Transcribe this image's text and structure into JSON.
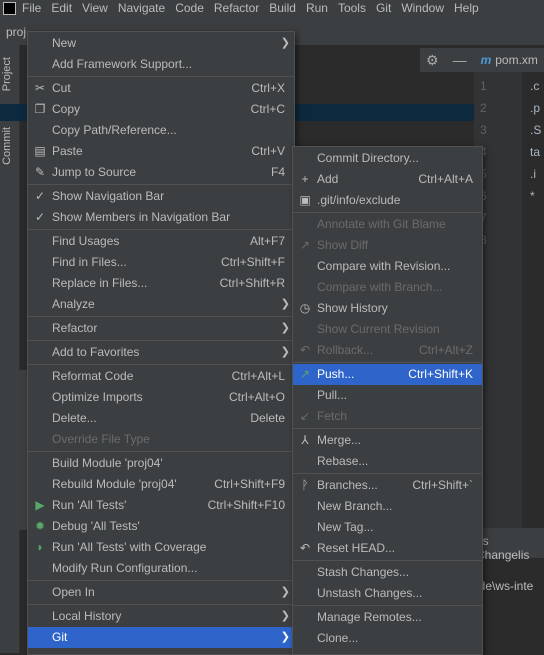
{
  "menubar": {
    "items": [
      "File",
      "Edit",
      "View",
      "Navigate",
      "Code",
      "Refactor",
      "Build",
      "Run",
      "Tools",
      "Git",
      "Window",
      "Help"
    ]
  },
  "project_tab": "proj",
  "left_tabs": {
    "project": "Project",
    "commit": "Commit"
  },
  "editor": {
    "tab_label": "pom.xm",
    "line_numbers": [
      "1",
      "2",
      "3",
      "4",
      "5",
      "6",
      "7",
      "8"
    ],
    "code_lines": [
      ".c",
      ".p",
      ".S",
      "ta",
      ".i",
      "*"
    ],
    "bottom_tab": "es Changelis",
    "bottom_path": "ide\\ws-inte"
  },
  "context_menu": {
    "new": "New",
    "add_framework_support": "Add Framework Support...",
    "cut": "Cut",
    "cut_sc": "Ctrl+X",
    "copy": "Copy",
    "copy_sc": "Ctrl+C",
    "copy_path": "Copy Path/Reference...",
    "paste": "Paste",
    "paste_sc": "Ctrl+V",
    "jump_to_source": "Jump to Source",
    "jump_sc": "F4",
    "show_nav_bar": "Show Navigation Bar",
    "show_members": "Show Members in Navigation Bar",
    "find_usages": "Find Usages",
    "find_usages_sc": "Alt+F7",
    "find_in_files": "Find in Files...",
    "find_in_files_sc": "Ctrl+Shift+F",
    "replace_in_files": "Replace in Files...",
    "replace_in_files_sc": "Ctrl+Shift+R",
    "analyze": "Analyze",
    "refactor": "Refactor",
    "add_to_favorites": "Add to Favorites",
    "reformat_code": "Reformat Code",
    "reformat_sc": "Ctrl+Alt+L",
    "optimize_imports": "Optimize Imports",
    "optimize_sc": "Ctrl+Alt+O",
    "delete": "Delete...",
    "delete_sc": "Delete",
    "override_file_type": "Override File Type",
    "build_module": "Build Module 'proj04'",
    "rebuild_module": "Rebuild Module 'proj04'",
    "rebuild_sc": "Ctrl+Shift+F9",
    "run_all_tests": "Run 'All Tests'",
    "run_sc": "Ctrl+Shift+F10",
    "debug_all_tests": "Debug 'All Tests'",
    "run_with_coverage": "Run 'All Tests' with Coverage",
    "modify_run_config": "Modify Run Configuration...",
    "open_in": "Open In",
    "local_history": "Local History",
    "git": "Git"
  },
  "git_menu": {
    "commit_directory": "Commit Directory...",
    "add": "Add",
    "add_sc": "Ctrl+Alt+A",
    "git_info_exclude": ".git/info/exclude",
    "annotate": "Annotate with Git Blame",
    "show_diff": "Show Diff",
    "compare_revision": "Compare with Revision...",
    "compare_branch": "Compare with Branch...",
    "show_history": "Show History",
    "show_current_revision": "Show Current Revision",
    "rollback": "Rollback...",
    "rollback_sc": "Ctrl+Alt+Z",
    "push": "Push...",
    "push_sc": "Ctrl+Shift+K",
    "pull": "Pull...",
    "fetch": "Fetch",
    "merge": "Merge...",
    "rebase": "Rebase...",
    "branches": "Branches...",
    "branches_sc": "Ctrl+Shift+`",
    "new_branch": "New Branch...",
    "new_tag": "New Tag...",
    "reset_head": "Reset HEAD...",
    "stash_changes": "Stash Changes...",
    "unstash_changes": "Unstash Changes...",
    "manage_remotes": "Manage Remotes...",
    "clone": "Clone..."
  },
  "colors": {
    "menu_bg": "#3c3f41",
    "highlight": "#2f65ca",
    "disabled_text": "#6b6b6b",
    "green_icon": "#59a869"
  }
}
